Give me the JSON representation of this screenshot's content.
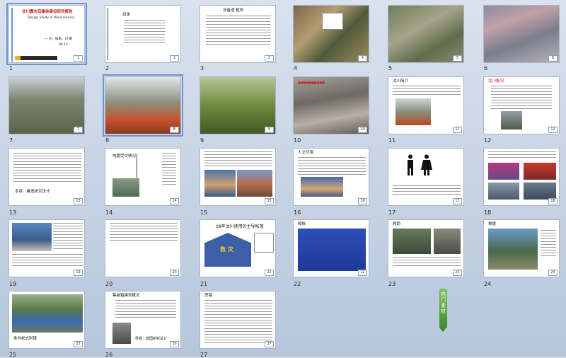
{
  "colors": {
    "background": "#c8d4e4",
    "selection": "#6d94d4",
    "accent_red": "#c7211e",
    "tag_green": "#4a9a36"
  },
  "slides": [
    {
      "n": "1",
      "title": "汶川震灾后集体建设研究报告",
      "sub": "Design Study of Wirid Hasiria",
      "author": "一 岁、候家、刘 猶",
      "date": "06.12"
    },
    {
      "n": "2",
      "title": "目录"
    },
    {
      "n": "3",
      "title": "设备遗 植所"
    },
    {
      "n": "4"
    },
    {
      "n": "5"
    },
    {
      "n": "6"
    },
    {
      "n": "7"
    },
    {
      "n": "8"
    },
    {
      "n": "9"
    },
    {
      "n": "10"
    },
    {
      "n": "11",
      "title": "汶川简介"
    },
    {
      "n": "12",
      "title": "北川概况"
    },
    {
      "n": "13",
      "title": "本章：建造研究设计"
    },
    {
      "n": "14",
      "title": "地震受灾情况"
    },
    {
      "n": "15"
    },
    {
      "n": "16",
      "title": "人文环境"
    },
    {
      "n": "17"
    },
    {
      "n": "18"
    },
    {
      "n": "19"
    },
    {
      "n": "20"
    },
    {
      "n": "21",
      "title": "08年汶川使用的主导帐篷",
      "banner": "救 灾"
    },
    {
      "n": "22",
      "title": "棉帐"
    },
    {
      "n": "23",
      "title": "救助"
    },
    {
      "n": "24",
      "title": "救援"
    },
    {
      "n": "25",
      "title": "条件帐式附篷"
    },
    {
      "n": "26",
      "title": "集装箱建筑概况",
      "footer": "导视：建国新新设计"
    },
    {
      "n": "27",
      "title": "思路："
    }
  ],
  "hot_tag": "热门素材"
}
